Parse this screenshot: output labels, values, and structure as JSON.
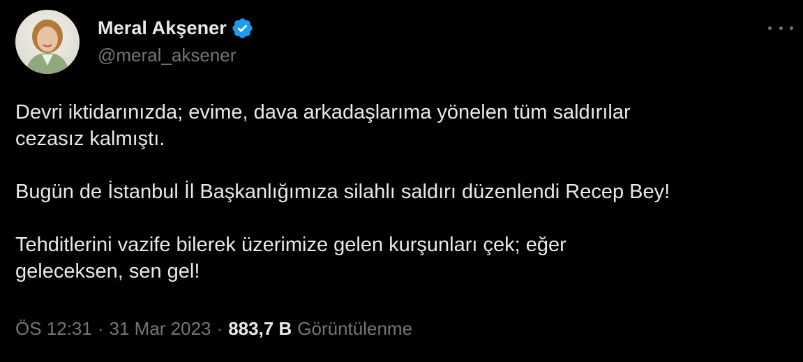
{
  "author": {
    "display_name": "Meral Akşener",
    "handle": "@meral_aksener",
    "verified": true
  },
  "tweet": {
    "paragraphs": [
      "Devri iktidarınızda; evime, dava arkadaşlarıma yönelen tüm saldırılar\ncezasız kalmıştı.",
      "Bugün de İstanbul İl Başkanlığımıza silahlı saldırı düzenlendi Recep Bey!",
      "Tehditlerini vazife bilerek üzerimize gelen kurşunları çek; eğer\ngeleceksen, sen gel!"
    ]
  },
  "meta": {
    "time": "ÖS 12:31",
    "separator": "·",
    "date": "31 Mar 2023",
    "views_count": "883,7 B",
    "views_label": "Görüntülenme"
  },
  "colors": {
    "background": "#000000",
    "text_primary": "#e7e9ea",
    "text_secondary": "#71767b",
    "verified_badge": "#1d9bf0"
  },
  "icons": {
    "verified": "verified-badge-icon",
    "more": "more-options-icon"
  }
}
